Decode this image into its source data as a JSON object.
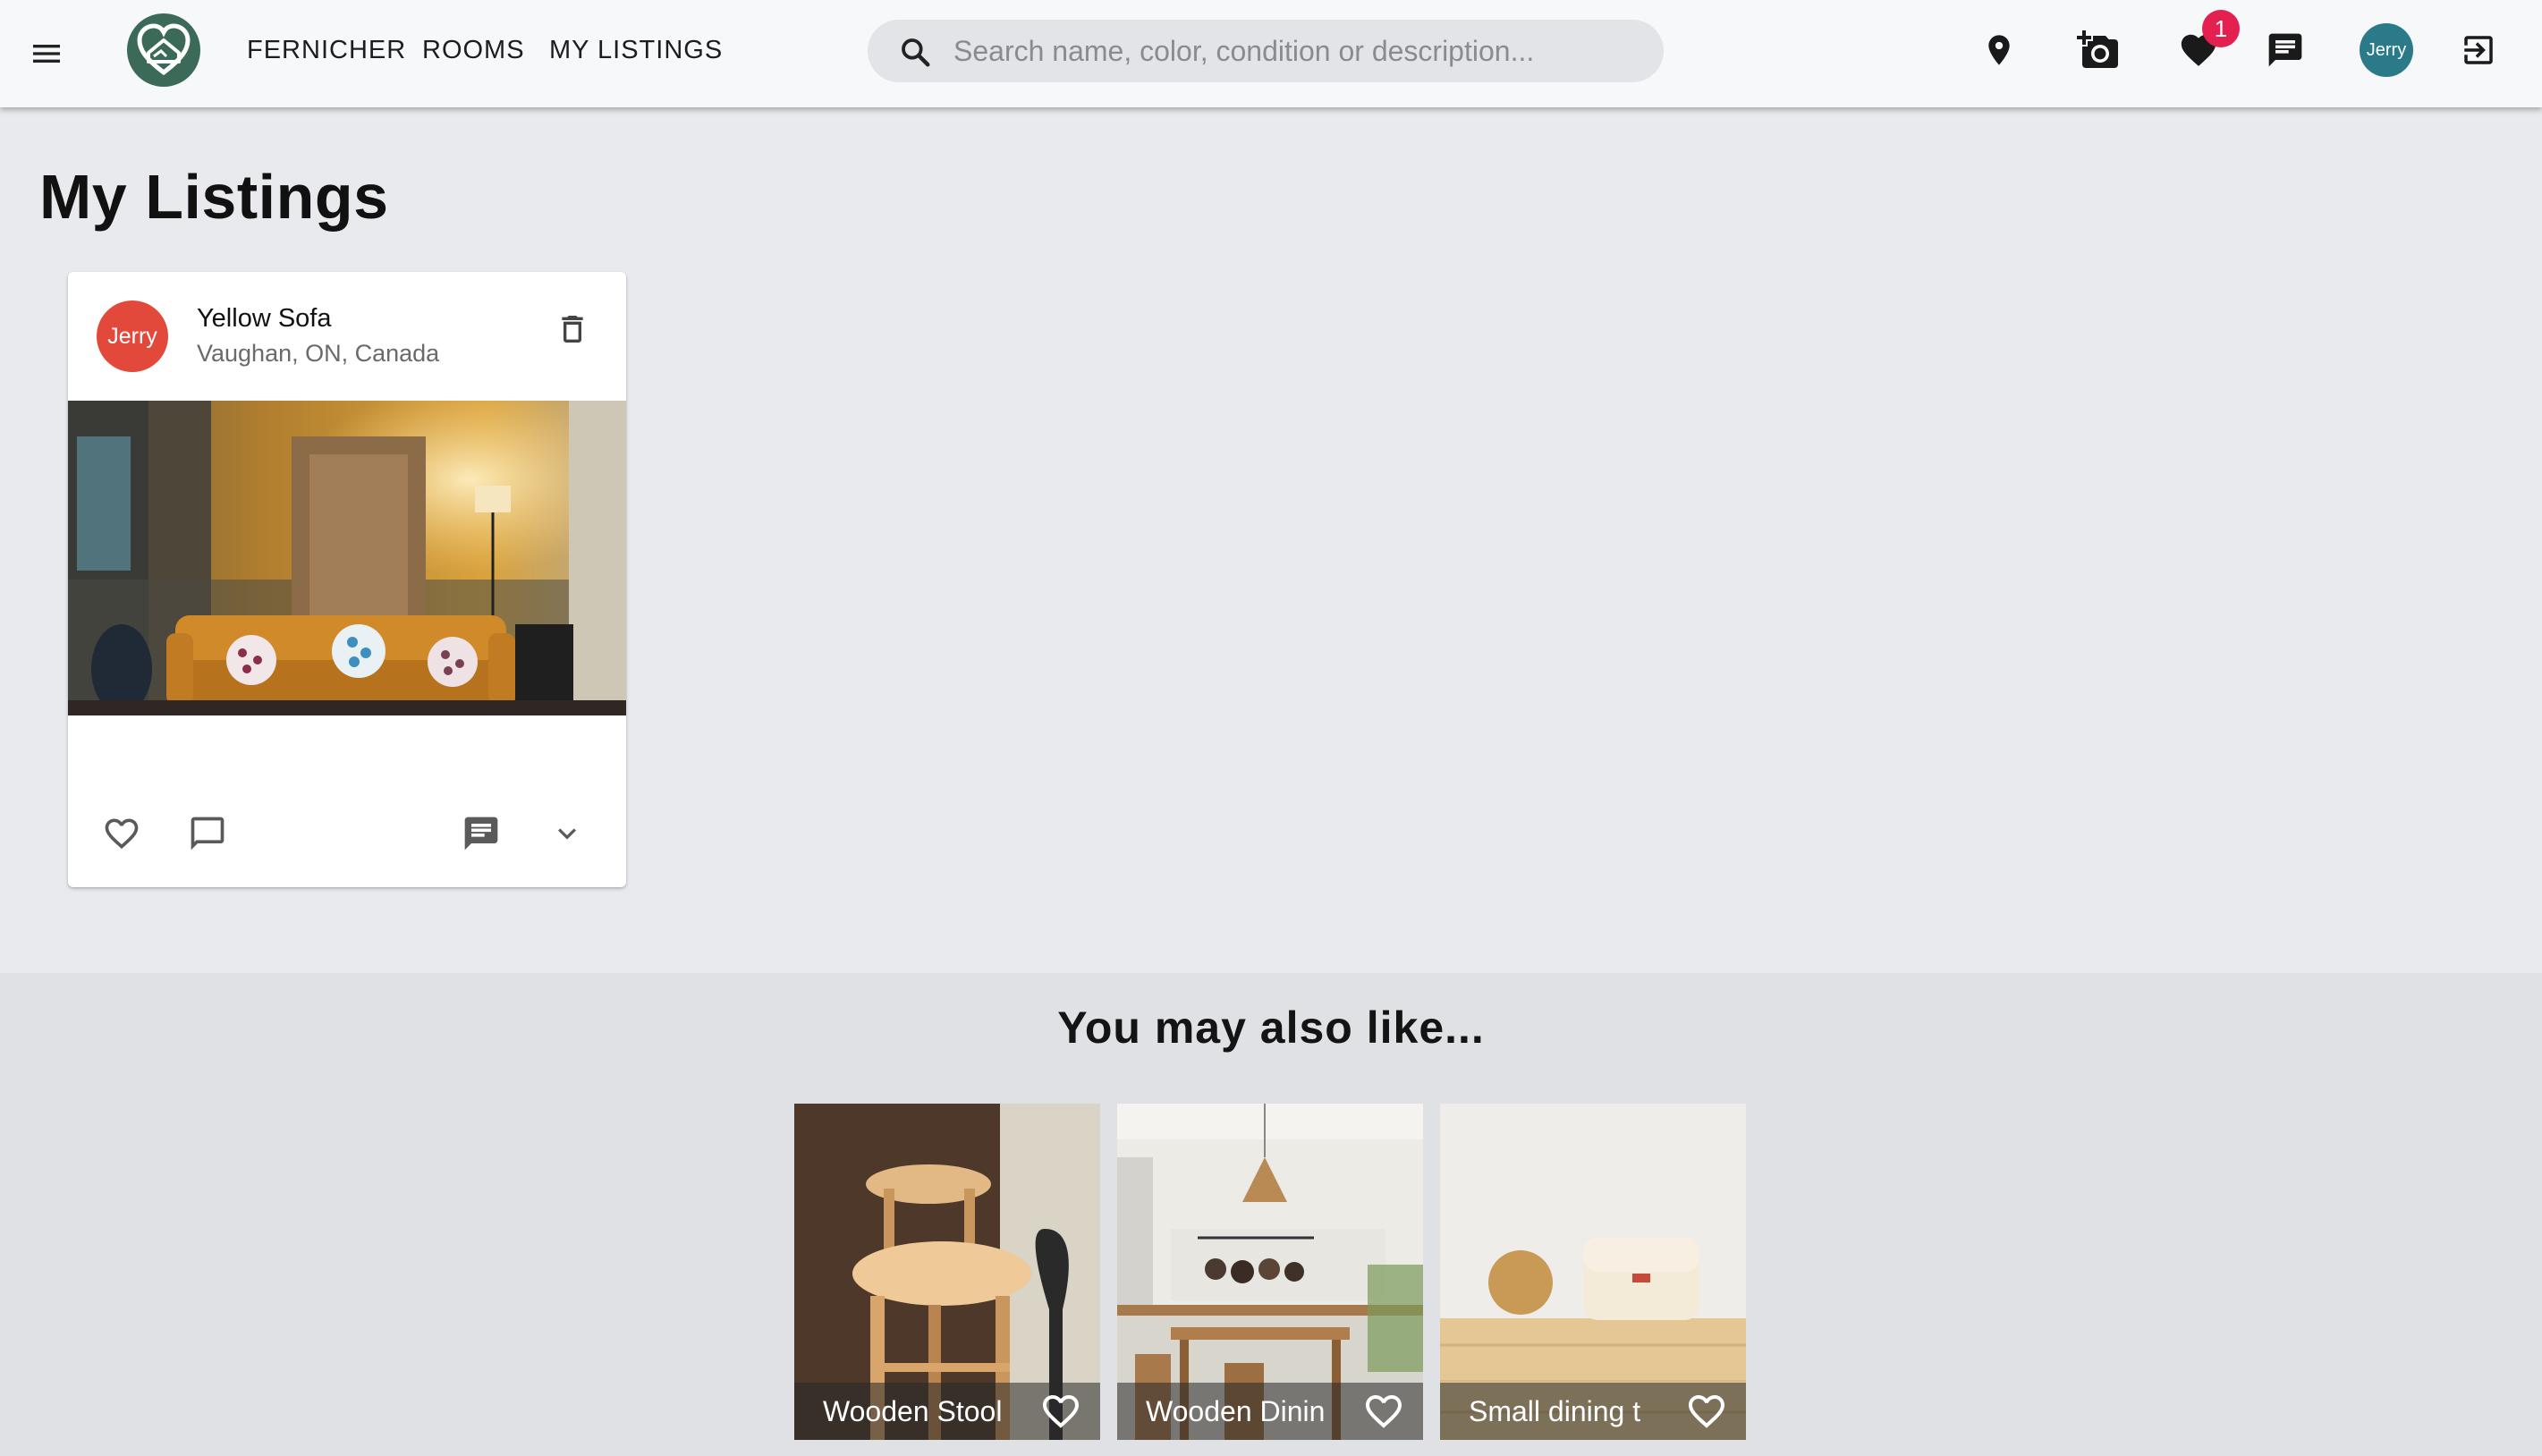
{
  "header": {
    "nav": {
      "fernicher": "FERNICHER",
      "rooms": "ROOMS",
      "my_listings": "MY LISTINGS"
    },
    "search": {
      "placeholder": "Search name, color, condition or description..."
    },
    "favorites_badge": "1",
    "user_avatar": "Jerry",
    "icons": [
      "menu-icon",
      "logo",
      "search-icon",
      "location-pin-icon",
      "add-photo-icon",
      "heart-icon",
      "chat-icon",
      "avatar",
      "logout-icon"
    ]
  },
  "page": {
    "title": "My Listings"
  },
  "listing": {
    "avatar": "Jerry",
    "title": "Yellow Sofa",
    "location": "Vaughan, ON, Canada"
  },
  "recommendations": {
    "title": "You may also like...",
    "items": [
      {
        "label": "Wooden Stool"
      },
      {
        "label": "Wooden Dinin"
      },
      {
        "label": "Small dining t"
      }
    ]
  },
  "colors": {
    "page_bg": "#e9eaee",
    "appbar_bg": "#f7f8fa",
    "badge": "#e3204f",
    "avatar_top": "#2b7a8a",
    "avatar_card": "#e2493b",
    "logo_green": "#3b6b58",
    "reco_bg": "#dfe1e5"
  }
}
